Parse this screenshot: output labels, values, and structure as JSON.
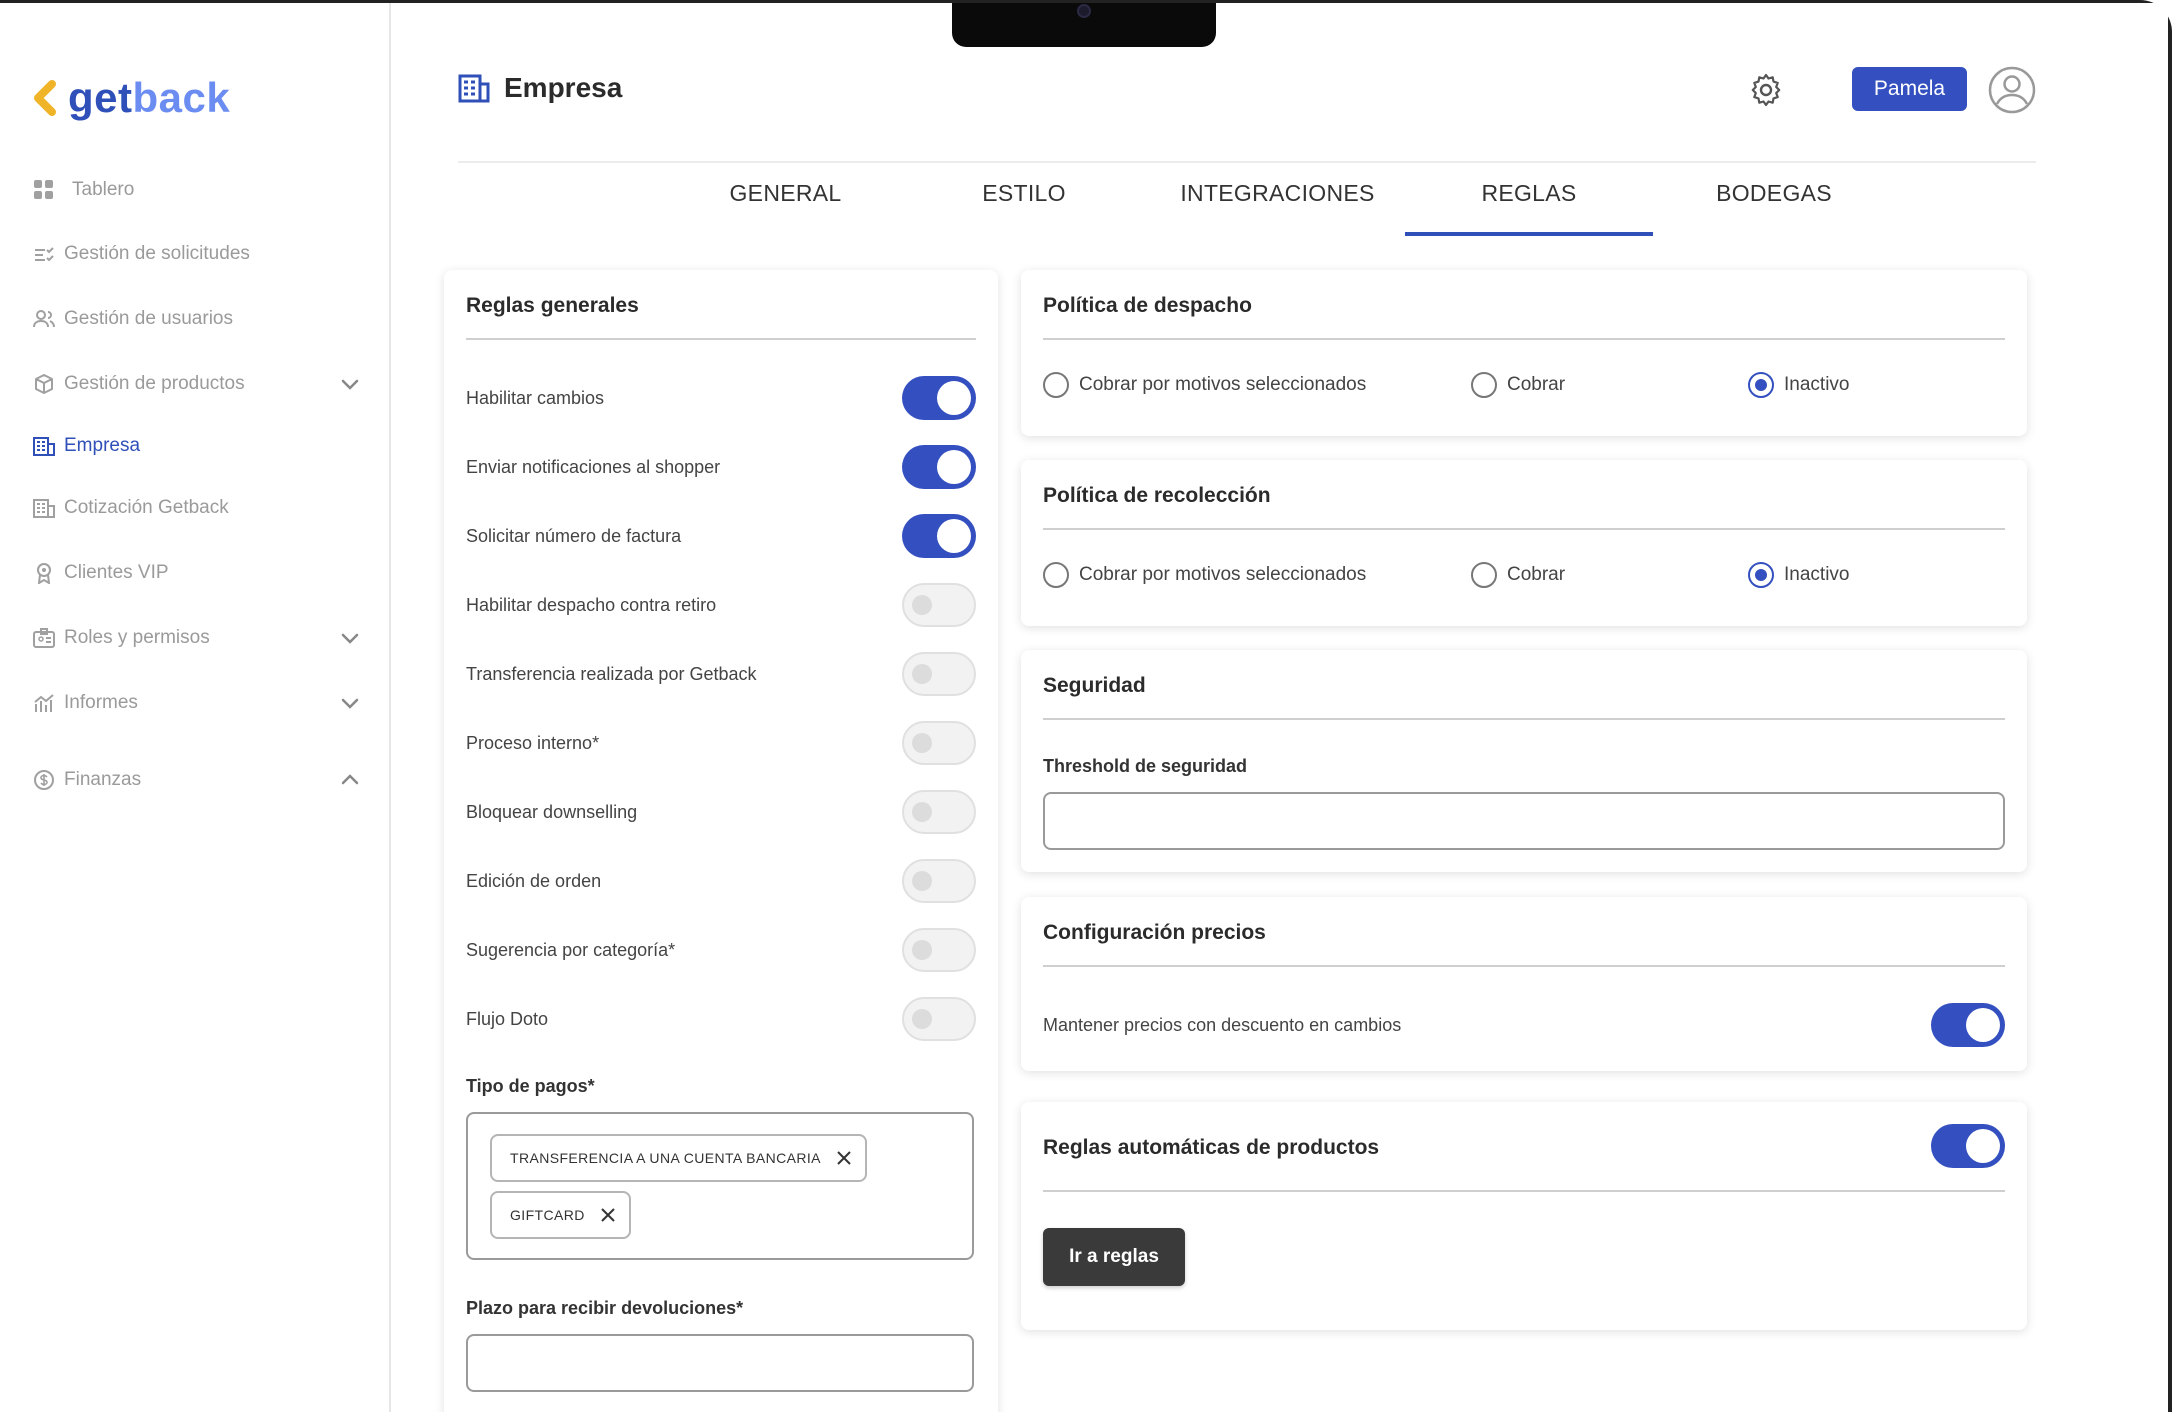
{
  "brand": {
    "logo_text_1": "get",
    "logo_text_2": "back",
    "accent": "#3450c0",
    "logo_chevron_color": "#f0b429"
  },
  "sidebar": {
    "items": [
      {
        "label": "Tablero",
        "icon": "grid-icon"
      },
      {
        "label": "Gestión de solicitudes",
        "icon": "checklist-icon"
      },
      {
        "label": "Gestión de usuarios",
        "icon": "users-icon"
      },
      {
        "label": "Gestión de productos",
        "icon": "box-icon",
        "expandable": true
      },
      {
        "label": "Empresa",
        "icon": "building-icon",
        "active": true
      },
      {
        "label": "Cotización Getback",
        "icon": "building-icon"
      },
      {
        "label": "Clientes VIP",
        "icon": "badge-icon"
      },
      {
        "label": "Roles y permisos",
        "icon": "id-card-icon",
        "expandable": true
      },
      {
        "label": "Informes",
        "icon": "chart-icon",
        "expandable": true
      },
      {
        "label": "Finanzas",
        "icon": "dollar-icon",
        "expandable": true,
        "expanded": true
      }
    ]
  },
  "header": {
    "title": "Empresa",
    "user_label": "Pamela"
  },
  "tabs": [
    {
      "label": "GENERAL"
    },
    {
      "label": "ESTILO"
    },
    {
      "label": "INTEGRACIONES"
    },
    {
      "label": "REGLAS",
      "active": true
    },
    {
      "label": "BODEGAS"
    }
  ],
  "general_rules": {
    "title": "Reglas generales",
    "rules": [
      {
        "label": "Habilitar cambios",
        "enabled": true
      },
      {
        "label": "Enviar notificaciones al shopper",
        "enabled": true
      },
      {
        "label": "Solicitar número de factura",
        "enabled": true
      },
      {
        "label": "Habilitar despacho contra retiro",
        "enabled": false
      },
      {
        "label": "Transferencia realizada por Getback",
        "enabled": false
      },
      {
        "label": "Proceso interno*",
        "enabled": false
      },
      {
        "label": "Bloquear downselling",
        "enabled": false
      },
      {
        "label": "Edición de orden",
        "enabled": false
      },
      {
        "label": "Sugerencia por categoría*",
        "enabled": false
      },
      {
        "label": "Flujo Doto",
        "enabled": false
      }
    ],
    "payment_types_label": "Tipo de pagos*",
    "payment_types": [
      "TRANSFERENCIA A UNA CUENTA BANCARIA",
      "GIFTCARD"
    ],
    "returns_deadline_label": "Plazo para recibir devoluciones*",
    "returns_deadline_value": ""
  },
  "dispatch_policy": {
    "title": "Política de despacho",
    "options": [
      "Cobrar por motivos seleccionados",
      "Cobrar",
      "Inactivo"
    ],
    "selected": "Inactivo"
  },
  "pickup_policy": {
    "title": "Política de recolección",
    "options": [
      "Cobrar por motivos seleccionados",
      "Cobrar",
      "Inactivo"
    ],
    "selected": "Inactivo"
  },
  "security": {
    "title": "Seguridad",
    "threshold_label": "Threshold de seguridad",
    "threshold_value": ""
  },
  "pricing": {
    "title": "Configuración precios",
    "keep_discount_label": "Mantener precios con descuento en cambios",
    "keep_discount_enabled": true
  },
  "auto_rules": {
    "title": "Reglas automáticas de productos",
    "enabled": true,
    "button_label": "Ir a reglas"
  }
}
